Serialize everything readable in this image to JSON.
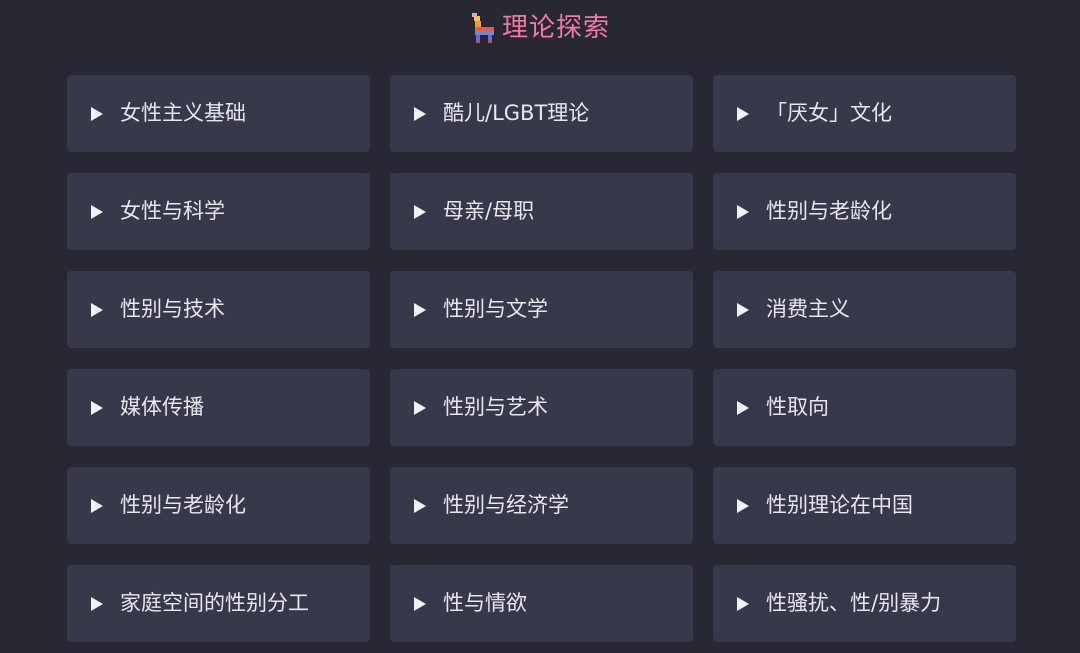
{
  "header": {
    "title": "理论探索",
    "icon": "pinata-icon"
  },
  "topics": [
    {
      "label": "女性主义基础"
    },
    {
      "label": "酷儿/LGBT理论"
    },
    {
      "label": "「厌女」文化"
    },
    {
      "label": " 女性与科学"
    },
    {
      "label": "母亲/母职"
    },
    {
      "label": "性别与老龄化"
    },
    {
      "label": "性别与技术"
    },
    {
      "label": "性别与文学"
    },
    {
      "label": "消费主义"
    },
    {
      "label": "媒体传播"
    },
    {
      "label": "性别与艺术"
    },
    {
      "label": "性取向"
    },
    {
      "label": "性别与老龄化"
    },
    {
      "label": "性别与经济学"
    },
    {
      "label": "性别理论在中国"
    },
    {
      "label": "家庭空间的性别分工"
    },
    {
      "label": "性与情欲"
    },
    {
      "label": "性骚扰、性/别暴力"
    }
  ],
  "colors": {
    "background": "#272833",
    "card": "#373849",
    "title": "#ef7aa5",
    "text": "#e7e7ee"
  }
}
